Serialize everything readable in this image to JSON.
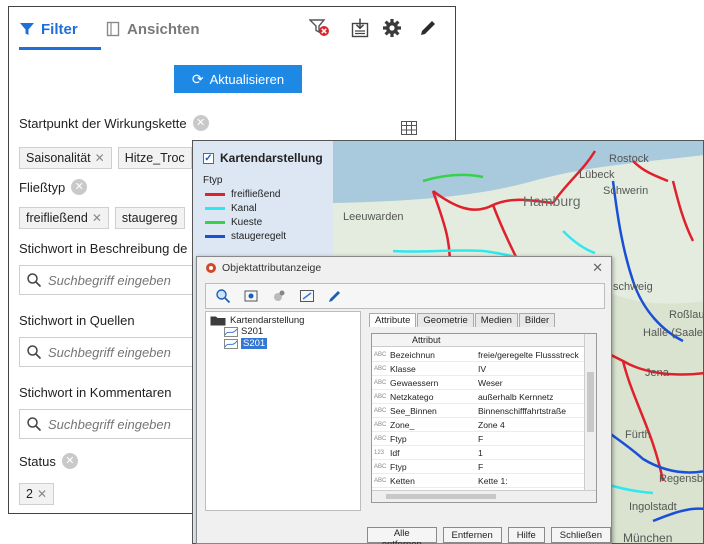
{
  "filter_panel": {
    "tabs": {
      "filter": "Filter",
      "views": "Ansichten"
    },
    "refresh_button": "Aktualisieren",
    "sections": {
      "startpunkt": {
        "label": "Startpunkt der Wirkungskette",
        "chips": [
          "Saisonalität",
          "Hitze_Troc"
        ]
      },
      "fliesstyp": {
        "label": "Fließtyp",
        "chips": [
          "freifließend",
          "staugereg"
        ]
      },
      "stichwort_beschreibung": {
        "label": "Stichwort in Beschreibung de",
        "placeholder": "Suchbegriff eingeben"
      },
      "stichwort_quellen": {
        "label": "Stichwort in Quellen",
        "placeholder": "Suchbegriff eingeben"
      },
      "stichwort_kommentare": {
        "label": "Stichwort in Kommentaren",
        "placeholder": "Suchbegriff eingeben"
      },
      "status": {
        "label": "Status",
        "chips": [
          "2"
        ]
      }
    }
  },
  "map_window": {
    "legend": {
      "title": "Kartendarstellung",
      "field": "Ftyp",
      "items": [
        {
          "label": "freifließend",
          "color": "#e0202b"
        },
        {
          "label": "Kanal",
          "color": "#2ee8f0"
        },
        {
          "label": "Kueste",
          "color": "#36d24a"
        },
        {
          "label": "staugeregelt",
          "color": "#1a4fd8"
        }
      ]
    },
    "places": {
      "rostock": "Rostock",
      "lubeck": "Lübeck",
      "schwerin": "Schwerin",
      "hamburg": "Hamburg",
      "leeuwarden": "Leeuwarden",
      "schweig": "schweig",
      "rosslau": "Roßlau",
      "halle": "Halle (Saale",
      "jena": "Jena",
      "furth": "Fürth",
      "ingolstadt": "Ingolstadt",
      "munchen": "München",
      "regensburg": "Regensburg"
    }
  },
  "attr_dialog": {
    "title": "Objektattributanzeige",
    "tree": {
      "root": "Kartendarstellung",
      "children": [
        "S201",
        "S201"
      ]
    },
    "tabs": [
      "Attribute",
      "Geometrie",
      "Medien",
      "Bilder"
    ],
    "column_header": "Attribut",
    "rows": [
      {
        "type": "ABC",
        "name": "Bezeichnun",
        "value": "freie/geregelte Flussstreck"
      },
      {
        "type": "ABC",
        "name": "Klasse",
        "value": "IV"
      },
      {
        "type": "ABC",
        "name": "Gewaessern",
        "value": "Weser"
      },
      {
        "type": "ABC",
        "name": "Netzkatego",
        "value": "außerhalb Kernnetz"
      },
      {
        "type": "ABC",
        "name": "See_Binnen",
        "value": "Binnenschifffahrtstraße"
      },
      {
        "type": "ABC",
        "name": "Zone_",
        "value": "Zone 4"
      },
      {
        "type": "ABC",
        "name": "Ftyp",
        "value": "F"
      },
      {
        "type": "123",
        "name": "Idf",
        "value": "1"
      },
      {
        "type": "ABC",
        "name": "Ftyp",
        "value": "F"
      },
      {
        "type": "ABC",
        "name": "Ketten",
        "value": "Kette 1:"
      }
    ],
    "buttons": [
      "Alle entfernen",
      "Entfernen",
      "Hilfe",
      "Schließen"
    ]
  }
}
